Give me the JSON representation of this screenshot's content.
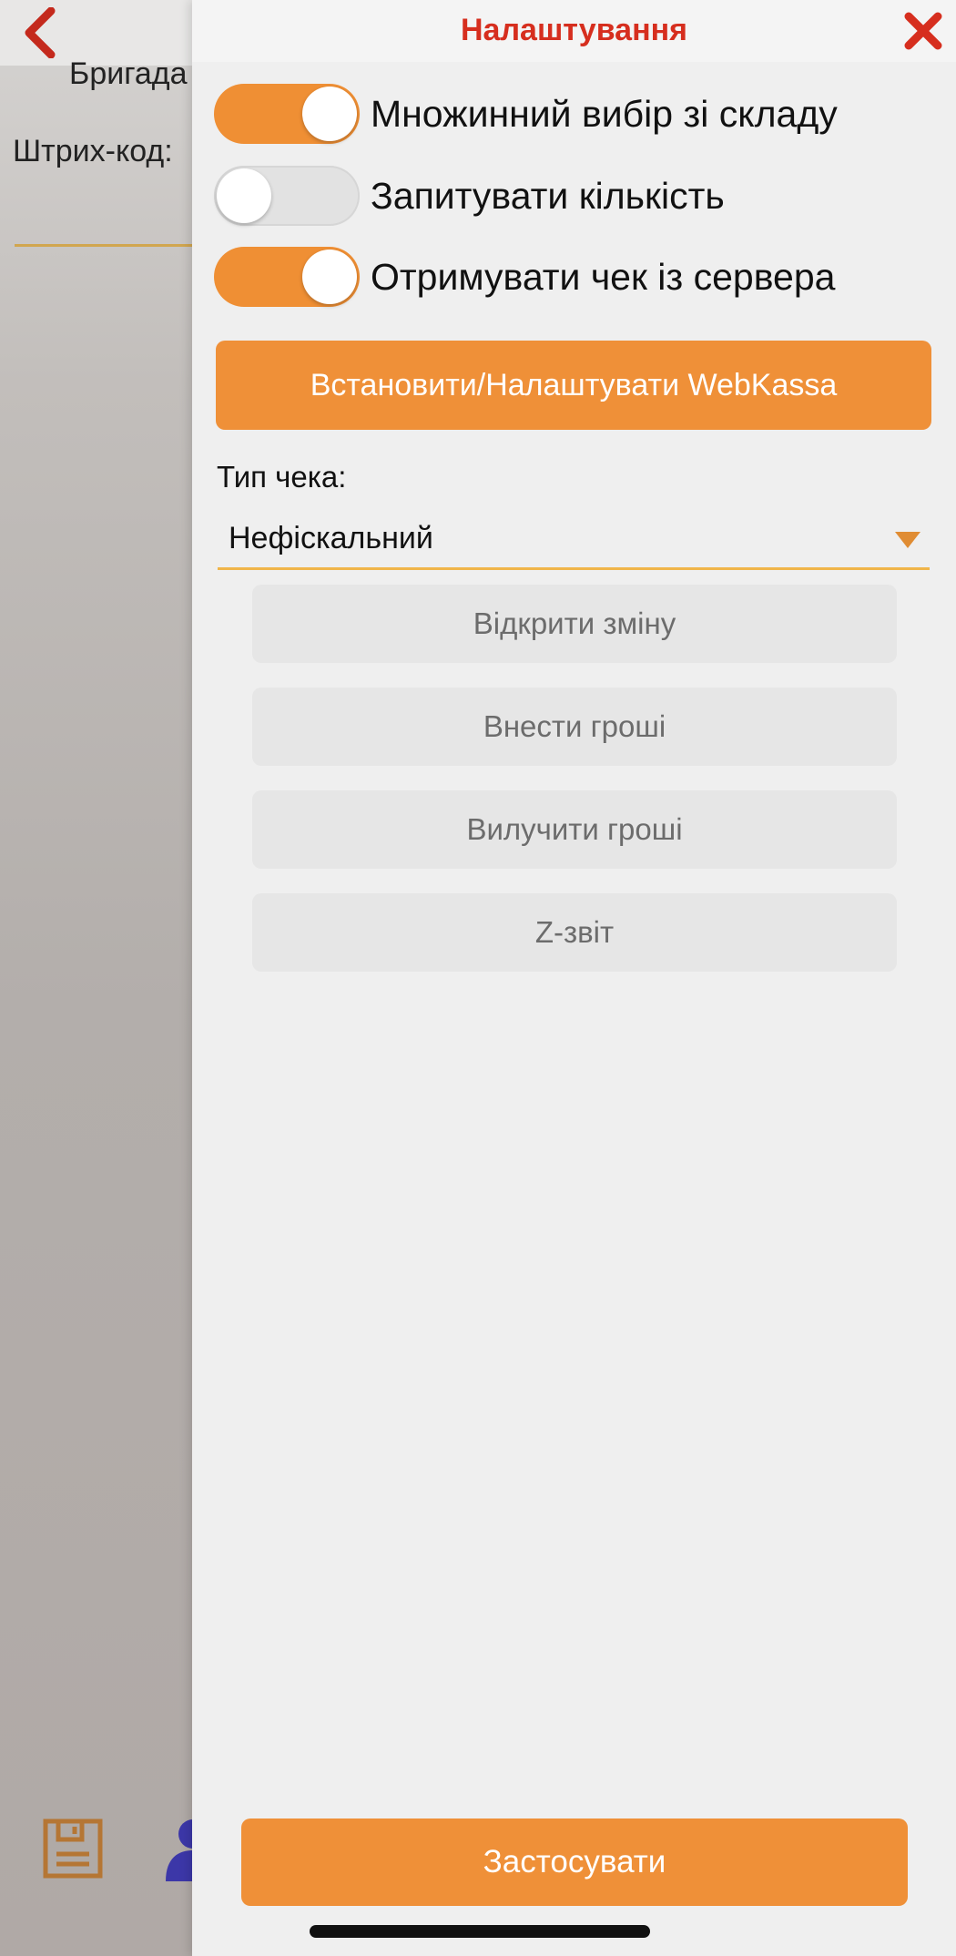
{
  "background": {
    "brigade_label": "Бригада",
    "barcode_label": "Штрих-код:"
  },
  "settings": {
    "title": "Налаштування",
    "toggles": [
      {
        "label": "Множинний вибір зі складу",
        "checked": true
      },
      {
        "label": "Запитувати кількість",
        "checked": false
      },
      {
        "label": "Отримувати чек із сервера",
        "checked": true
      }
    ],
    "webkassa_button": "Встановити/Налаштувати WebKassa",
    "receipt_type_label": "Тип чека:",
    "receipt_type_value": "Нефіскальний",
    "actions": {
      "open_shift": "Відкрити зміну",
      "deposit_money": "Внести гроші",
      "withdraw_money": "Вилучити гроші",
      "z_report": "Z-звіт"
    },
    "apply_button": "Застосувати"
  },
  "colors": {
    "accent": "#ef9038",
    "title_red": "#d62e1e",
    "panel_bg": "#efefef",
    "disabled_button_bg": "#e6e6e6",
    "disabled_button_text": "#6c6c6c"
  },
  "icons": {
    "back": "chevron-left-icon",
    "close": "close-icon",
    "dropdown": "triangle-down-icon",
    "save": "save-icon",
    "user": "user-icon"
  }
}
